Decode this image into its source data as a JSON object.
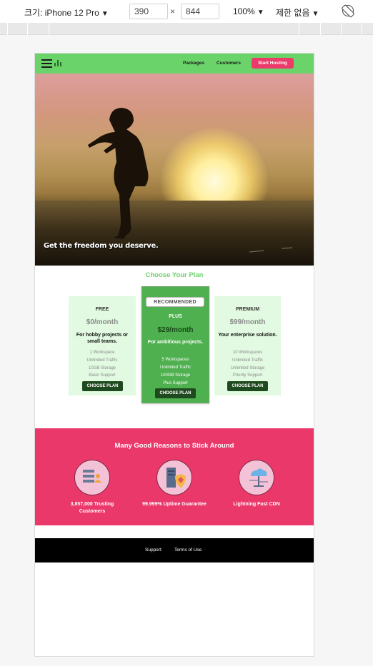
{
  "devtools": {
    "device_label": "크기: iPhone 12 Pro",
    "width": "390",
    "height": "844",
    "times": "×",
    "zoom": "100%",
    "throttle": "제한 없음",
    "caret": "▼"
  },
  "site": {
    "accent_green": "#6ad36a",
    "accent_pink": "#ea386a",
    "nav": {
      "links": [
        "Packages",
        "Customers"
      ],
      "cta": "Start Hosting"
    },
    "hero": {
      "caption": "Get the freedom you deserve."
    },
    "plans": {
      "title": "Choose Your Plan",
      "items": [
        {
          "name": "FREE",
          "price": "$0/month",
          "desc": "For hobby projects or small teams.",
          "features": [
            "1 Workspace",
            "Unlimited Traffic",
            "10GB Storage",
            "Basic Support"
          ],
          "button": "CHOOSE PLAN"
        },
        {
          "badge": "RECOMMENDED",
          "name": "PLUS",
          "price": "$29/month",
          "desc": "For ambitious projects.",
          "features": [
            "5 Workspaces",
            "Unlimited Traffic",
            "100GB Storage",
            "Plus Support"
          ],
          "button": "CHOOSE PLAN"
        },
        {
          "name": "PREMIUM",
          "price": "$99/month",
          "desc": "Your enterprise solution.",
          "features": [
            "10 Workspaces",
            "Unlimited Traffic",
            "Unlimited Storage",
            "Priority Support"
          ],
          "button": "CHOOSE PLAN"
        }
      ]
    },
    "reasons": {
      "title": "Many Good Reasons to Stick Around",
      "items": [
        {
          "icon": "customers-icon",
          "label": "3,857,000 Trusting Customers"
        },
        {
          "icon": "uptime-shield-icon",
          "label": "99.999% Uptime Guarantee"
        },
        {
          "icon": "cloud-cdn-icon",
          "label": "Lightning Fast CDN"
        }
      ]
    },
    "footer": {
      "links": [
        "Support",
        "Terms of Use"
      ]
    }
  }
}
